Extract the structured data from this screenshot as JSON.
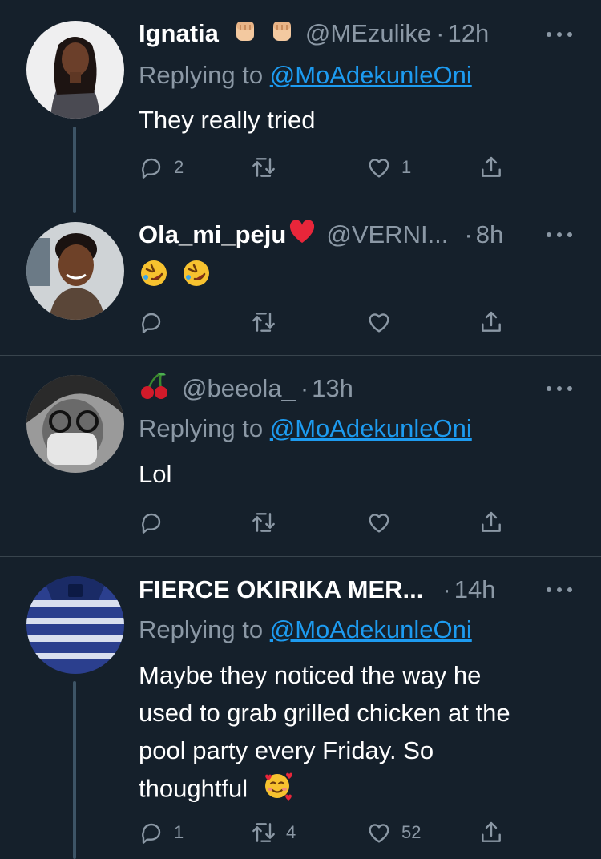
{
  "tweets": [
    {
      "name": "Ignatia",
      "handle": "@MEzulike",
      "time": "12h",
      "replying_label": "Replying to",
      "replying_to": "@MoAdekunleOni",
      "text": "They really tried",
      "replies": "2",
      "retweets": "",
      "likes": "1"
    },
    {
      "name": "Ola_mi_peju",
      "handle": "@VERNI...",
      "time": "8h",
      "text_emoji": "rolling-on-floor-laughing x2",
      "replies": "",
      "retweets": "",
      "likes": ""
    },
    {
      "name": "",
      "handle": "@beeola_",
      "time": "13h",
      "replying_label": "Replying to",
      "replying_to": "@MoAdekunleOni",
      "text": "Lol",
      "replies": "",
      "retweets": "",
      "likes": ""
    },
    {
      "name": "FIERCE OKIRIKA MER...",
      "handle": "",
      "time": "14h",
      "replying_label": "Replying to",
      "replying_to": "@MoAdekunleOni",
      "text_lines": [
        "Maybe they noticed the way he",
        "used to grab grilled chicken at the",
        "pool party every Friday. So",
        "thoughtful"
      ],
      "replies": "1",
      "retweets": "4",
      "likes": "52"
    }
  ],
  "icons": {
    "name_badges": [
      "raised-fist-icon",
      "raised-fist-icon",
      "red-heart-icon",
      "cherries-icon"
    ],
    "actions": [
      "reply-icon",
      "retweet-icon",
      "like-icon",
      "share-icon"
    ],
    "more": "more-options-icon"
  },
  "colors": {
    "background": "#15202b",
    "text": "#ffffff",
    "secondary": "#8b98a5",
    "link": "#1d9bf0",
    "separator": "#38444d"
  }
}
